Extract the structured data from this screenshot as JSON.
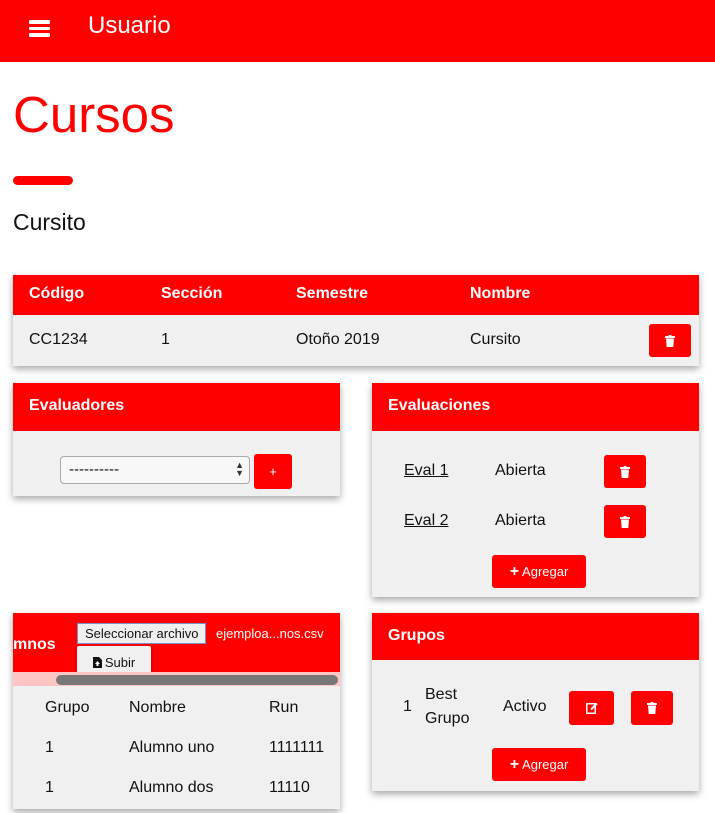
{
  "navbar": {
    "brand": "Usuario",
    "menu_icon": "hamburger-icon"
  },
  "page": {
    "title": "Cursos",
    "course_name": "Cursito"
  },
  "course_table": {
    "headers": [
      "Código",
      "Sección",
      "Semestre",
      "Nombre"
    ],
    "row": {
      "codigo": "CC1234",
      "seccion": "1",
      "semestre": "Otoño 2019",
      "nombre": "Cursito"
    }
  },
  "evaluadores": {
    "title": "Evaluadores",
    "select_value": "----------",
    "add_label": "+"
  },
  "evaluaciones": {
    "title": "Evaluaciones",
    "items": [
      {
        "name": "Eval 1",
        "status": "Abierta"
      },
      {
        "name": "Eval 2",
        "status": "Abierta"
      }
    ],
    "add_label": "Agregar"
  },
  "alumnos": {
    "title_fragment": "mnos",
    "file_button": "Seleccionar archivo",
    "file_name": "ejemploa...nos.csv",
    "upload_label": "Subir",
    "headers": [
      "Grupo",
      "Nombre",
      "Run"
    ],
    "rows": [
      {
        "grupo": "1",
        "nombre": "Alumno uno",
        "run": "1111111"
      },
      {
        "grupo": "1",
        "nombre": "Alumno dos",
        "run": "11110"
      }
    ]
  },
  "grupos": {
    "title": "Grupos",
    "items": [
      {
        "num": "1",
        "name_line1": "Best",
        "name_line2": "Grupo",
        "status": "Activo"
      }
    ],
    "add_label": "Agregar"
  },
  "colors": {
    "accent": "#ff0000",
    "panel": "#f0f0f0"
  }
}
